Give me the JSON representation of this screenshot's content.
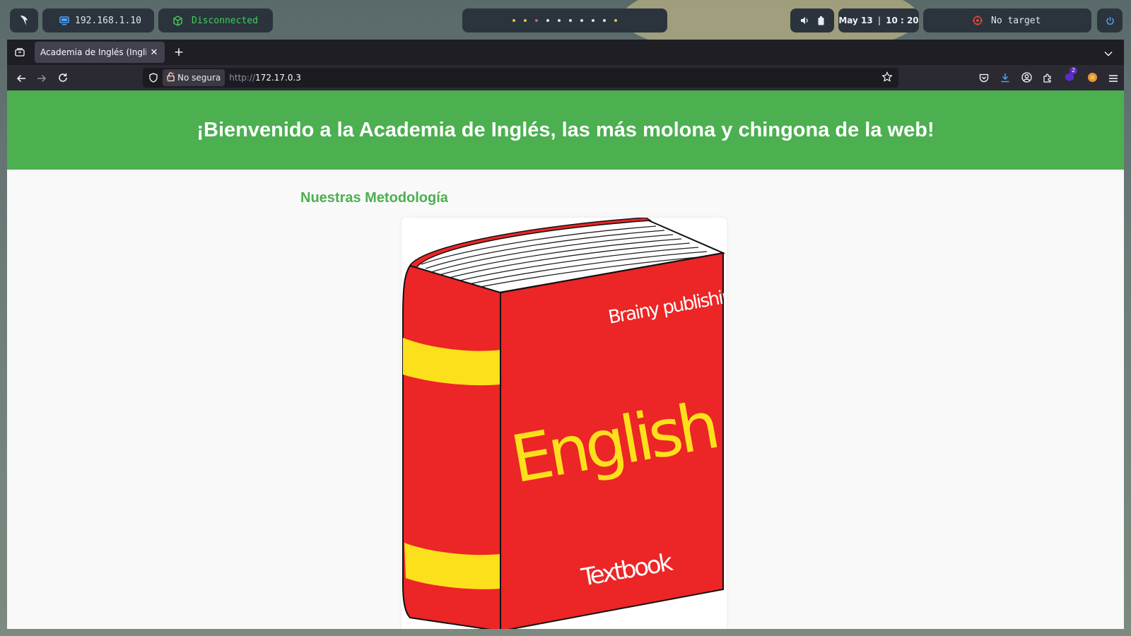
{
  "desktop_bar": {
    "ip": "192.168.1.10",
    "vpn_status": "Disconnected",
    "date": "May 13",
    "time": "10 : 20",
    "target": "No target",
    "colors": {
      "vpn_green": "#3ecf5b",
      "target_red": "#e0443a",
      "power_blue": "#4fa3f7"
    }
  },
  "browser": {
    "tab_title": "Academia de Inglés (Inglis A",
    "address": {
      "security_label": "No segura",
      "url_prefix": "http://",
      "url_host": "172.17.0.3"
    },
    "extension_badge": "2"
  },
  "page": {
    "header_title": "¡Bienvenido a la Academia de Inglés, las más molona y chingona de la web!",
    "section_title": "Nuestras Metodología",
    "book": {
      "publisher": "Brainy publishing",
      "title": "English",
      "subtitle": "Textbook"
    },
    "colors": {
      "header_green": "#4caf50",
      "book_red": "#ec2526",
      "book_yellow": "#fde01c"
    }
  }
}
